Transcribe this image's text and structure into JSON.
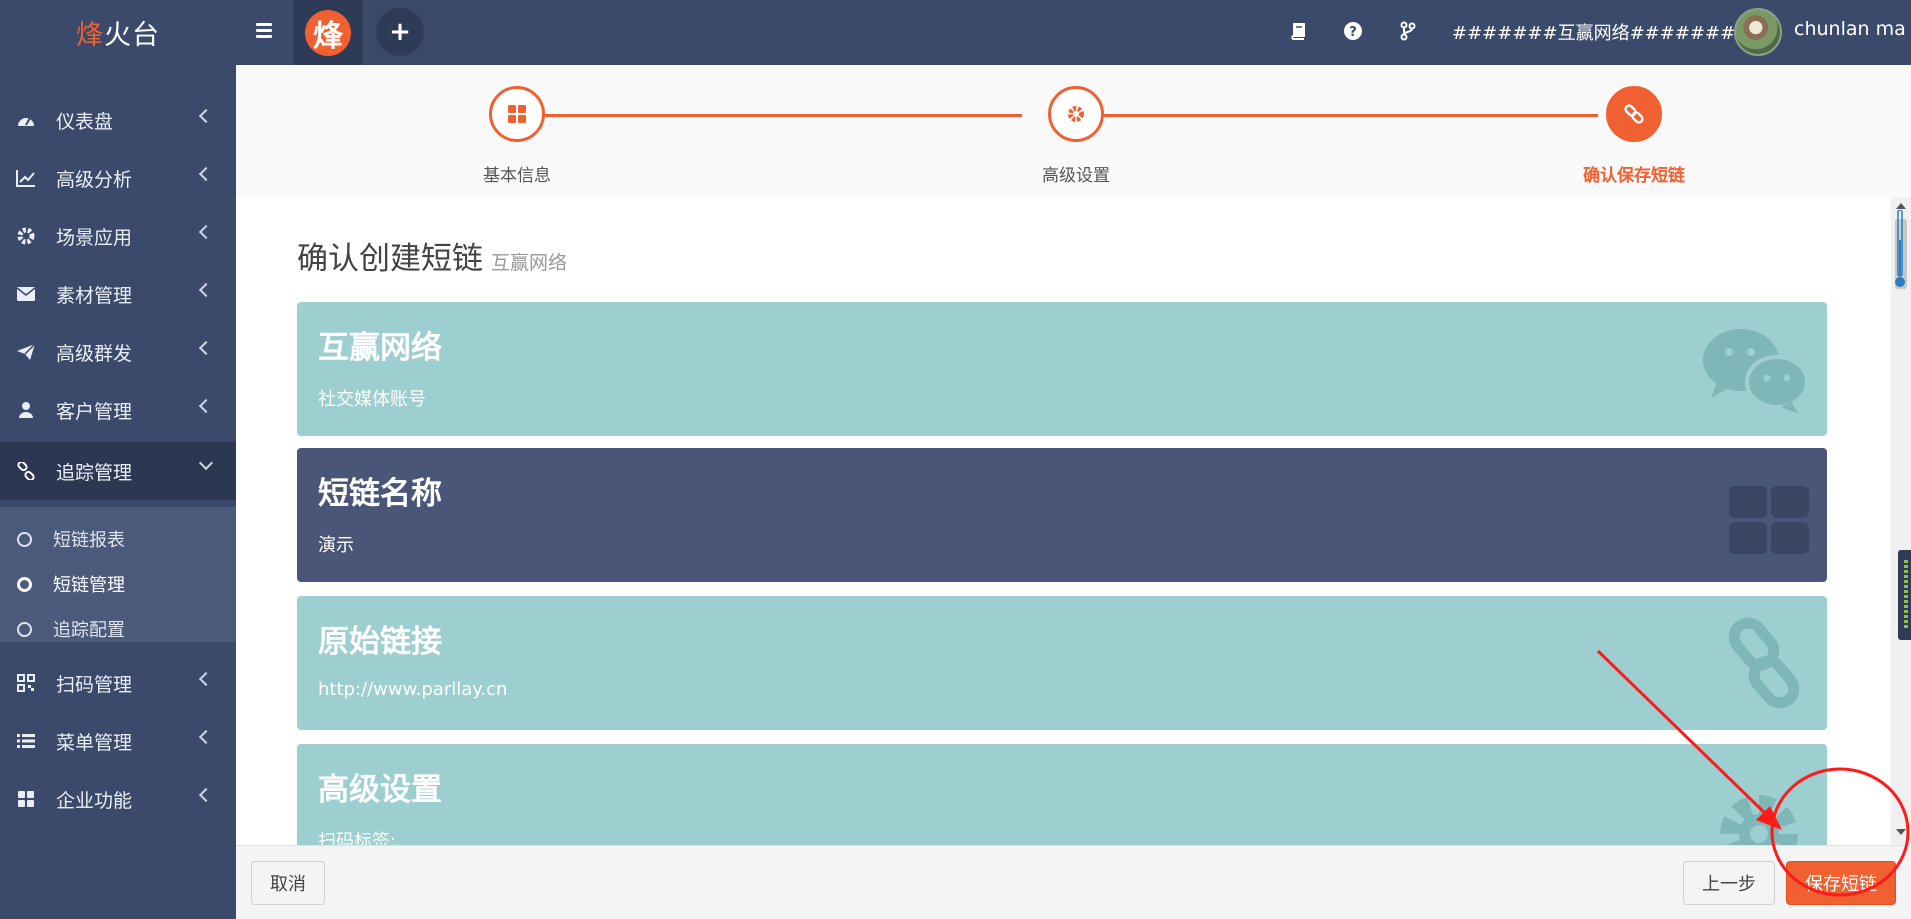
{
  "app": {
    "brand_accent": "烽",
    "brand_rest": "火台",
    "logo_char": "烽",
    "plus_symbol": "+",
    "org_selector": "#######互赢网络#######",
    "username": "chunlan ma"
  },
  "topbar_icons": [
    "book-icon",
    "help-icon",
    "branch-icon"
  ],
  "sidebar": {
    "items": [
      {
        "label": "仪表盘",
        "icon": "dashboard-icon"
      },
      {
        "label": "高级分析",
        "icon": "line-chart-icon"
      },
      {
        "label": "场景应用",
        "icon": "gear-icon"
      },
      {
        "label": "素材管理",
        "icon": "envelope-icon"
      },
      {
        "label": "高级群发",
        "icon": "paper-plane-icon"
      },
      {
        "label": "客户管理",
        "icon": "user-icon"
      },
      {
        "label": "追踪管理",
        "icon": "link-icon"
      },
      {
        "label": "扫码管理",
        "icon": "qrcode-icon"
      },
      {
        "label": "菜单管理",
        "icon": "list-icon"
      },
      {
        "label": "企业功能",
        "icon": "grid-icon"
      }
    ],
    "submenu": [
      {
        "label": "短链报表"
      },
      {
        "label": "短链管理"
      },
      {
        "label": "追踪配置"
      }
    ]
  },
  "wizard": {
    "steps": [
      {
        "label": "基本信息",
        "icon": "grid-icon"
      },
      {
        "label": "高级设置",
        "icon": "gear-icon"
      },
      {
        "label": "确认保存短链",
        "icon": "link-icon"
      }
    ]
  },
  "content": {
    "title": "确认创建短链",
    "subtitle": "互赢网络",
    "cards": [
      {
        "title": "互赢网络",
        "value": "社交媒体账号",
        "icon": "wechat-icon"
      },
      {
        "title": "短链名称",
        "value": "演示",
        "icon": "grid-icon"
      },
      {
        "title": "原始链接",
        "value": "http://www.parllay.cn",
        "icon": "chain-link-icon"
      },
      {
        "title": "高级设置",
        "value": "扫码标签:",
        "icon": "gear-icon"
      }
    ]
  },
  "footer": {
    "cancel": "取消",
    "prev": "上一步",
    "save": "保存短链"
  },
  "colors": {
    "accent": "#f06030",
    "sidebar_bg": "#3b4a6b",
    "card_teal": "#9dcfd1",
    "card_navy": "#4a5677",
    "annotation_red": "#ff1a1a"
  }
}
